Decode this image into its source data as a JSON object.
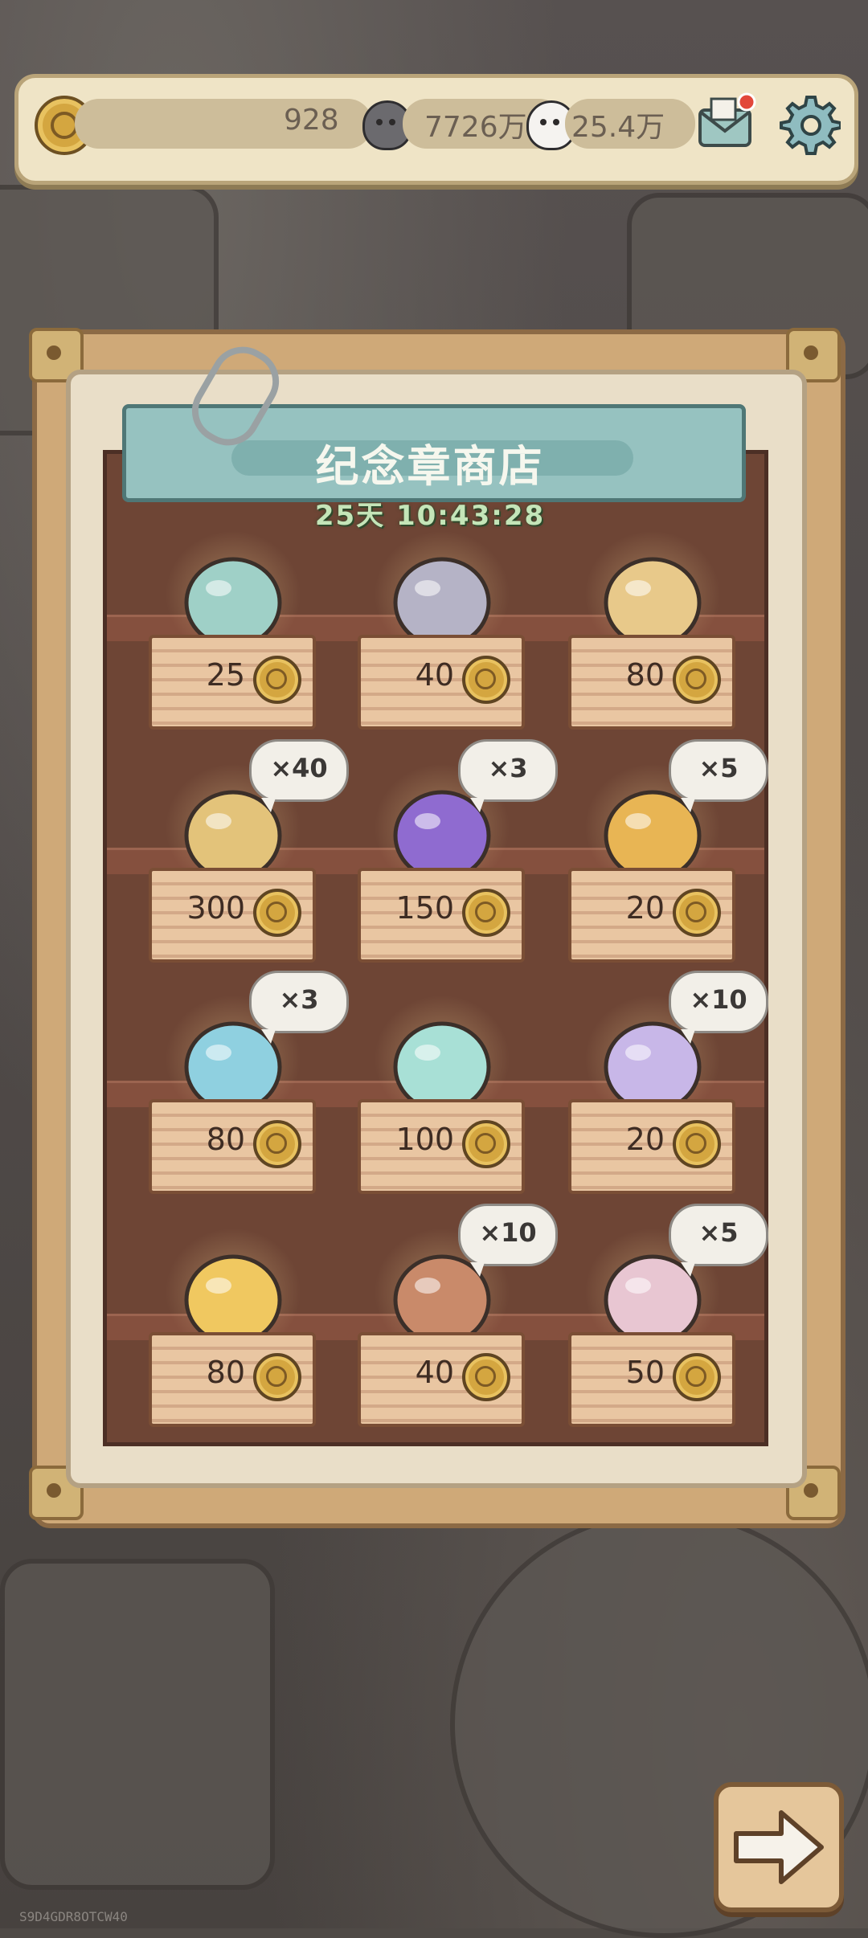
{
  "resources": {
    "medal_count": "928",
    "ghost_dark_count": "7726万",
    "ghost_light_count": "25.4万"
  },
  "shop": {
    "title": "纪念章商店",
    "timer": "25天 10:43:28"
  },
  "items": [
    {
      "name": "rainbow-jar",
      "price": "25",
      "qty": ""
    },
    {
      "name": "armored-box",
      "price": "40",
      "qty": ""
    },
    {
      "name": "mushroom-crystal",
      "price": "80",
      "qty": ""
    },
    {
      "name": "golden-cannon",
      "price": "300",
      "qty": "×40"
    },
    {
      "name": "purple-orb",
      "price": "150",
      "qty": "×3"
    },
    {
      "name": "jeweled-chest",
      "price": "20",
      "qty": "×5"
    },
    {
      "name": "blue-armor",
      "price": "80",
      "qty": "×3"
    },
    {
      "name": "ribbon-gift",
      "price": "100",
      "qty": ""
    },
    {
      "name": "crystal-cluster",
      "price": "20",
      "qty": "×10"
    },
    {
      "name": "golden-pearl",
      "price": "80",
      "qty": ""
    },
    {
      "name": "rose-chest",
      "price": "40",
      "qty": "×10"
    },
    {
      "name": "pink-cards",
      "price": "50",
      "qty": "×5"
    }
  ],
  "watermark": "S9D4GDR8OTCW40",
  "colors": {
    "accent_teal": "#96c2c0",
    "coin_gold": "#d4a640",
    "panel_wood": "#6e4535"
  },
  "icons": {
    "mail": "mail-icon",
    "settings": "gear-icon",
    "next": "arrow-right-icon"
  }
}
